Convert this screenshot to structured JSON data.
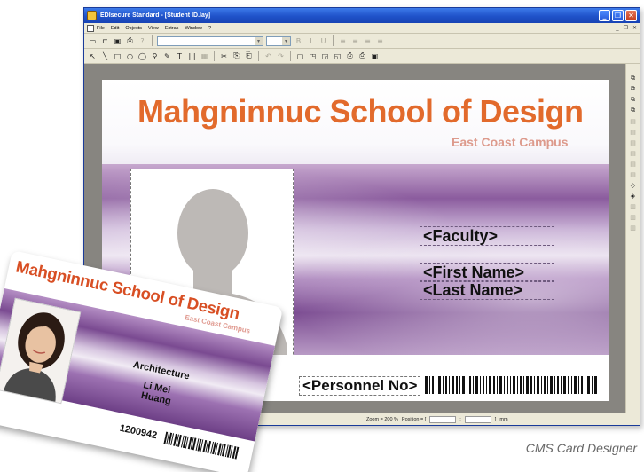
{
  "window": {
    "title": "EDIsecure Standard - [Student ID.lay]",
    "controls": {
      "minimize": "_",
      "restore": "❐",
      "close": "✕"
    }
  },
  "menubar": {
    "items": [
      "File",
      "Edit",
      "Objects",
      "View",
      "Extras",
      "Window",
      "?"
    ],
    "mdi_controls": [
      "_",
      "❐",
      "✕"
    ]
  },
  "toolbar1": {
    "icons": [
      "new-icon",
      "open-icon",
      "save-icon",
      "print-icon",
      "help-icon"
    ],
    "format_icons": [
      "B",
      "I",
      "U",
      "≡",
      "≡",
      "≡",
      "≡"
    ]
  },
  "toolbar2": {
    "tools": [
      "↖",
      "╲",
      "□",
      "○",
      "◯",
      "⚲",
      "✎",
      "T",
      "|||",
      "▦",
      "✂",
      "⎘",
      "⎗",
      "↶",
      "↷",
      "▢",
      "◳",
      "◲",
      "◱",
      "⎙",
      "⎙",
      "▣"
    ]
  },
  "right_toolbar": {
    "tools": [
      "⧉",
      "⧉",
      "⧉",
      "⧉",
      "▤",
      "▤",
      "▤",
      "▤",
      "▤",
      "▤",
      "◇",
      "◈",
      "▥",
      "▥",
      "▥"
    ]
  },
  "statusbar": {
    "zoom": "Zoom = 200 %",
    "position_label": "Position = [",
    "separator": ";",
    "close_bracket": "]",
    "unit": "mm"
  },
  "design_card": {
    "title": "Mahgninnuc School of Design",
    "subtitle": "East Coast Campus",
    "fields": {
      "faculty": "<Faculty>",
      "first_name": "<First Name>",
      "last_name": "<Last Name>",
      "personnel_no": "<Personnel No>"
    }
  },
  "printed_card": {
    "title": "Mahgninnuc School of Design",
    "subtitle": "East Coast Campus",
    "faculty": "Architecture",
    "first_name": "Li Mei",
    "last_name": "Huang",
    "personnel_no": "1200942"
  },
  "caption": "CMS Card Designer",
  "colors": {
    "title_orange": "#e26a2c",
    "subtitle_pink": "#dd9a8c",
    "titlebar_blue": "#1f52c9",
    "workspace_gray": "#878580"
  }
}
